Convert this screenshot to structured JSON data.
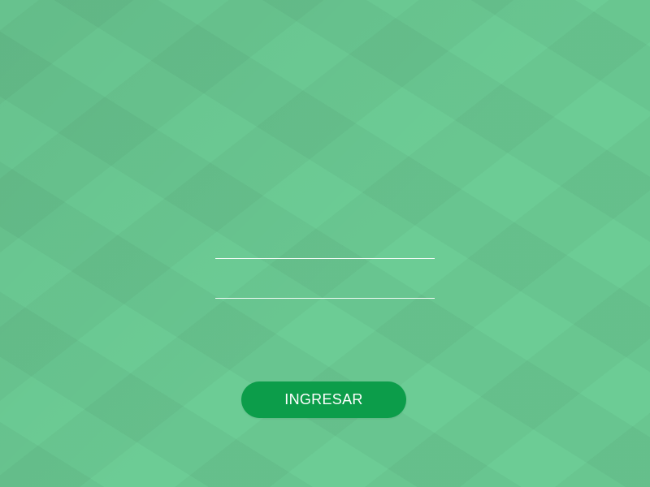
{
  "login": {
    "username": {
      "value": "",
      "placeholder": ""
    },
    "password": {
      "value": "",
      "placeholder": ""
    },
    "submit_label": "INGRESAR"
  },
  "colors": {
    "background": "#6ccc95",
    "button": "#0c9d4a",
    "button_text": "#ffffff",
    "field_underline": "#ffffff"
  }
}
